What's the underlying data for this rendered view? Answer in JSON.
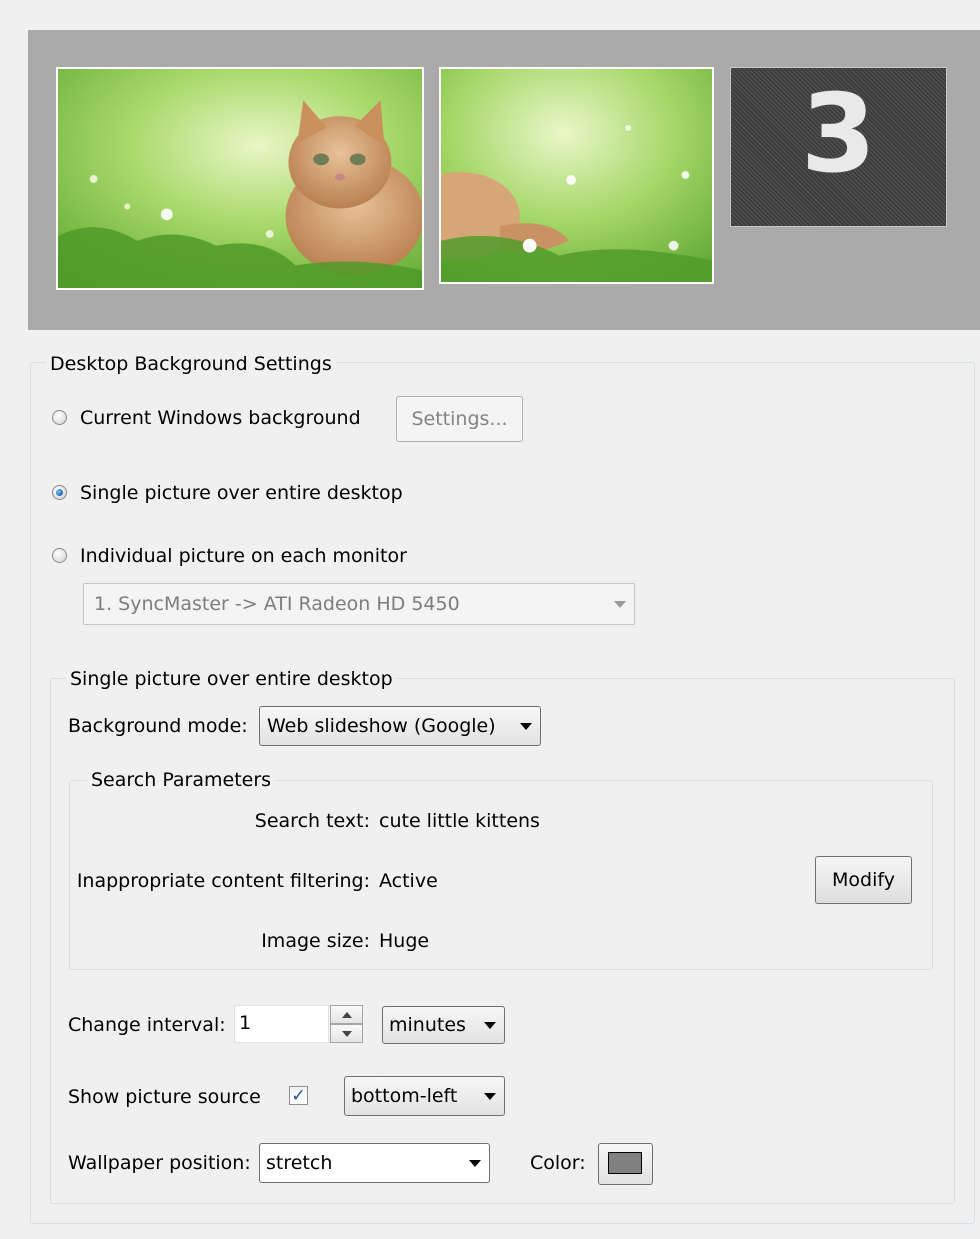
{
  "preview": {
    "monitor3_number": "3"
  },
  "settings_group": {
    "title": "Desktop Background Settings",
    "radio_current": "Current Windows background",
    "settings_button": "Settings...",
    "radio_single": "Single picture over entire desktop",
    "radio_individual": "Individual picture on each monitor",
    "selected": "single",
    "monitor_select": "1. SyncMaster -> ATI Radeon HD 5450"
  },
  "single_group": {
    "title": "Single picture over entire desktop",
    "mode_label": "Background mode:",
    "mode_value": "Web slideshow (Google)",
    "search": {
      "title": "Search Parameters",
      "text_label": "Search text:",
      "text_value": "cute little kittens",
      "filter_label": "Inappropriate content filtering:",
      "filter_value": "Active",
      "size_label": "Image size:",
      "size_value": "Huge",
      "modify_button": "Modify"
    },
    "interval_label": "Change interval:",
    "interval_value": "1",
    "interval_unit": "minutes",
    "source_label": "Show picture source",
    "source_checked": true,
    "source_position": "bottom-left",
    "position_label": "Wallpaper position:",
    "position_value": "stretch",
    "color_label": "Color:",
    "color_value": "#808080"
  }
}
